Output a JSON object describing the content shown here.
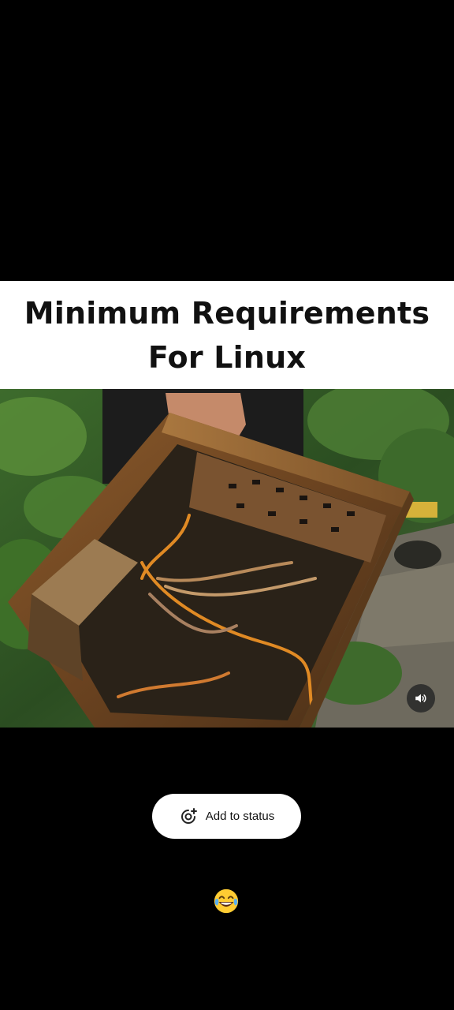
{
  "post": {
    "caption_line1": "Minimum Requirements",
    "caption_line2": "For Linux",
    "image_subject": "rusted-computer-case-photo"
  },
  "controls": {
    "mute_icon": "speaker-volume-icon",
    "add_status_label": "Add to status",
    "add_status_icon": "add-status-ring-icon"
  },
  "reaction": {
    "emoji": "😂",
    "icon": "laughing-tears-emoji"
  },
  "colors": {
    "background": "#000000",
    "caption_band": "#ffffff",
    "button_bg": "#ffffff"
  }
}
